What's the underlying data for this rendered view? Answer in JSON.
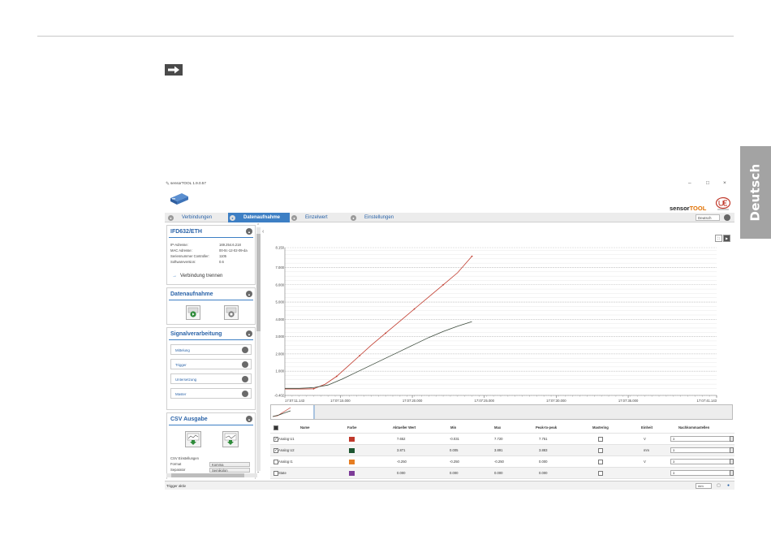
{
  "page": {
    "side_tab": "Deutsch"
  },
  "window": {
    "title": "sensorTOOL 1.9.0.57",
    "controls": [
      "–",
      "□",
      "×"
    ],
    "brand_prefix": "sensor",
    "brand_suffix": "TOOL"
  },
  "nav": {
    "items": [
      {
        "label": "Verbindungen",
        "active": false
      },
      {
        "label": "Datenaufnahme",
        "active": true
      },
      {
        "label": "Einzelwert",
        "active": false
      },
      {
        "label": "Einstellungen",
        "active": false
      }
    ],
    "language": "Deutsch"
  },
  "panel": {
    "device": {
      "title": "IFD632/ETH",
      "rows": [
        {
          "k": "IP-Adresse:",
          "v": "169.254.6.218"
        },
        {
          "k": "MAC Adresse:",
          "v": "00-0c-12-02-09-da"
        },
        {
          "k": "Seriennummer Controller:",
          "v": "1105"
        },
        {
          "k": "Softwareversion:",
          "v": "0.6"
        }
      ],
      "disconnect": "Verbindung trennen"
    },
    "acquisition": {
      "title": "Datenaufnahme"
    },
    "signal": {
      "title": "Signalverarbeitung",
      "items": [
        "Mittelung",
        "Trigger",
        "Untersetzung",
        "Master"
      ]
    },
    "csv": {
      "title": "CSV Ausgabe",
      "settings_label": "CSV Einstellungen",
      "format_label": "Format",
      "format_value": "Komma",
      "separator_label": "Separator",
      "separator_value": "Semikolon"
    }
  },
  "table": {
    "headers": [
      "Name",
      "Farbe",
      "Aktueller Wert",
      "Min",
      "Max",
      "Peak-to-peak",
      "Mastering",
      "Einheit",
      "Nachkommastellen"
    ],
    "rows": [
      {
        "name": "Analog U1",
        "checked": true,
        "color": "#c0392b",
        "current": "7.652",
        "min": "-0.031",
        "max": "7.720",
        "p2p": "7.751",
        "unit": "V",
        "decimals": "3"
      },
      {
        "name": "Analog U2",
        "checked": true,
        "color": "#1e5631",
        "current": "3.871",
        "min": "0.005",
        "max": "3.891",
        "p2p": "3.883",
        "unit": "mm",
        "decimals": "3"
      },
      {
        "name": "Analog I1",
        "checked": false,
        "color": "#e67e22",
        "current": "-0.250",
        "min": "-0.250",
        "max": "-0.250",
        "p2p": "0.000",
        "unit": "V",
        "decimals": "3"
      },
      {
        "name": "State",
        "checked": false,
        "color": "#7d3c98",
        "current": "0.000",
        "min": "0.000",
        "max": "0.000",
        "p2p": "0.000",
        "unit": "",
        "decimals": "3"
      }
    ]
  },
  "status": {
    "text": "Trigger aktiv",
    "unit": "mm"
  },
  "chart_data": {
    "type": "line",
    "title": "",
    "xlabel": "",
    "ylabel": "",
    "ylim": [
      -0.402,
      8.15
    ],
    "y_ticks": [
      "8.150",
      "7.000",
      "6.000",
      "5.000",
      "4.000",
      "3.000",
      "2.000",
      "1.000",
      "-0.402"
    ],
    "y_tick_values": [
      8.15,
      7,
      6,
      5,
      4,
      3,
      2,
      1,
      -0.402
    ],
    "x_ticks": [
      "17:07:11.143",
      "17:07:15.000",
      "17:07:20.000",
      "17:07:25.000",
      "17:07:30.000",
      "17:07:35.000",
      "17:07:41.143"
    ],
    "x_tick_values": [
      0,
      3.857,
      8.857,
      13.857,
      18.857,
      23.857,
      30
    ],
    "xlim": [
      0,
      30
    ],
    "grid": true,
    "series": [
      {
        "color": "#c0392b",
        "markers": true,
        "x": [
          0,
          1.0,
          2.0,
          2.8,
          3.6,
          4.4,
          5.2,
          6.0,
          7.0,
          8.0,
          9.0,
          10.0,
          11.0,
          12.0,
          13.0
        ],
        "y": [
          -0.031,
          -0.031,
          -0.02,
          0.25,
          0.7,
          1.3,
          1.9,
          2.5,
          3.2,
          3.9,
          4.6,
          5.3,
          6.0,
          6.7,
          7.652
        ]
      },
      {
        "color": "#3b4a3b",
        "markers": false,
        "x": [
          0,
          1.0,
          2.0,
          3.0,
          4.0,
          5.0,
          6.0,
          7.0,
          8.0,
          9.0,
          10.0,
          11.0,
          12.0,
          13.0
        ],
        "y": [
          0.005,
          0.005,
          0.05,
          0.2,
          0.55,
          0.95,
          1.35,
          1.75,
          2.15,
          2.55,
          2.95,
          3.3,
          3.6,
          3.871
        ]
      }
    ]
  }
}
